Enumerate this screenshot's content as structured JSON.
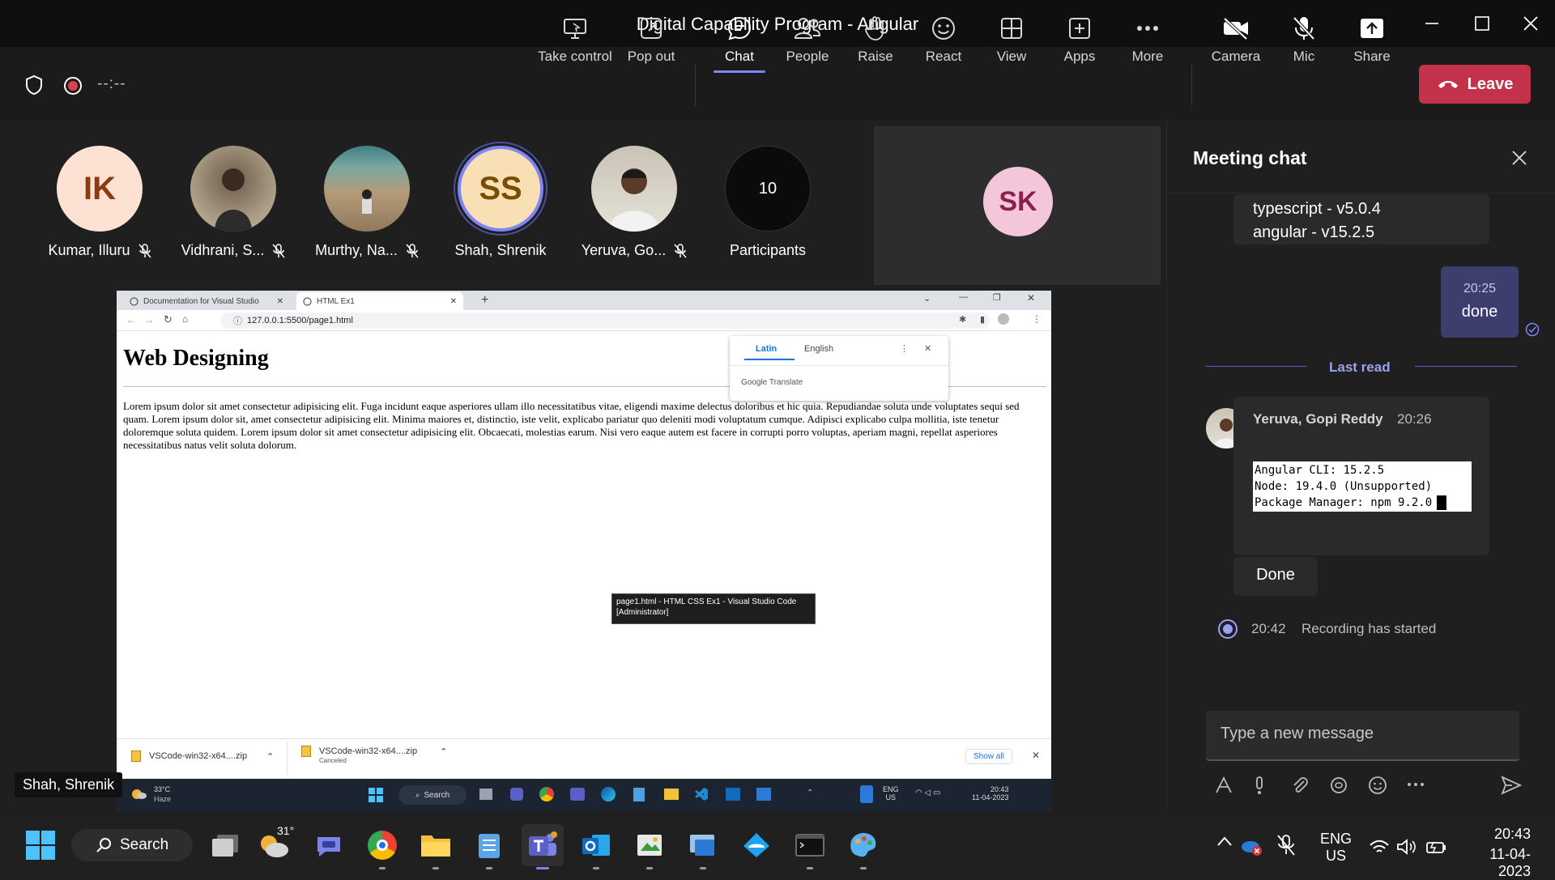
{
  "window": {
    "title": "Digital Capability Program - Angular"
  },
  "toolbar": {
    "timer": "--:--",
    "buttons": [
      {
        "label": "Take control"
      },
      {
        "label": "Pop out"
      },
      {
        "label": "Chat"
      },
      {
        "label": "People"
      },
      {
        "label": "Raise"
      },
      {
        "label": "React"
      },
      {
        "label": "View"
      },
      {
        "label": "Apps"
      },
      {
        "label": "More"
      },
      {
        "label": "Camera"
      },
      {
        "label": "Mic"
      },
      {
        "label": "Share"
      }
    ],
    "leave_label": "Leave"
  },
  "participants": [
    {
      "initials": "IK",
      "name": "Kumar, Illuru"
    },
    {
      "initials": "",
      "name": "Vidhrani, S..."
    },
    {
      "initials": "",
      "name": "Murthy, Na..."
    },
    {
      "initials": "SS",
      "name": "Shah, Shrenik"
    },
    {
      "initials": "",
      "name": "Yeruva, Go..."
    },
    {
      "count": "10",
      "name": "Participants"
    }
  ],
  "self_tile": {
    "initials": "SK"
  },
  "presenter_label": "Shah, Shrenik",
  "browser": {
    "tabs": [
      "Documentation for Visual Studio",
      "HTML Ex1"
    ],
    "url": "127.0.0.1:5500/page1.html",
    "page_heading": "Web Designing",
    "page_text": "Lorem ipsum dolor sit amet consectetur adipisicing elit. Fuga incidunt eaque asperiores ullam illo necessitatibus vitae, eligendi maxime delectus doloribus et hic quia. Repudiandae soluta unde voluptates sequi sed quam. Lorem ipsum dolor sit, amet consectetur adipisicing elit. Minima maiores et, distinctio, iste velit, explicabo pariatur quo deleniti modi voluptatum cumque. Adipisci explicabo culpa mollitia, iste tenetur doloremque soluta quidem. Lorem ipsum dolor sit amet consectetur adipisicing elit. Obcaecati, molestias earum. Nisi vero eaque autem est facere in corrupti porro voluptas, aperiam magni, repellat asperiores necessitatibus natus velit soluta dolorum.",
    "translate": {
      "tab1": "Latin",
      "tab2": "English",
      "brand": "Google Translate"
    },
    "tooltip": "page1.html - HTML CSS Ex1 - Visual Studio Code [Administrator]",
    "downloads": [
      {
        "name": "VSCode-win32-x64....zip",
        "status": ""
      },
      {
        "name": "VSCode-win32-x64....zip",
        "status": "Canceled"
      }
    ],
    "show_all": "Show all"
  },
  "shared_taskbar": {
    "weather_temp": "33°C",
    "weather_desc": "Haze",
    "search": "Search",
    "lang1": "ENG",
    "lang2": "US",
    "time": "20:43",
    "date": "11-04-2023"
  },
  "chat": {
    "title": "Meeting chat",
    "msg_partial": [
      "typescript - v5.0.4",
      "angular - v15.2.5"
    ],
    "my_msg_time": "20:25",
    "my_msg_text": "done",
    "last_read": "Last read",
    "sender": "Yeruva, Gopi Reddy",
    "sender_time": "20:26",
    "code_lines": [
      "Angular CLI: 15.2.5",
      "Node: 19.4.0 (Unsupported)",
      "Package Manager: npm 9.2.0"
    ],
    "done_msg": "Done",
    "event_time": "20:42",
    "event_text": "Recording has started",
    "composer_placeholder": "Type a new message"
  },
  "taskbar": {
    "search": "Search",
    "weather_temp": "31°",
    "lang1": "ENG",
    "lang2": "US",
    "time": "20:43",
    "date": "11-04-2023"
  },
  "colors": {
    "accent": "#7f85f5",
    "leave": "#c4314b",
    "chat_bg": "#1f1f1f"
  }
}
